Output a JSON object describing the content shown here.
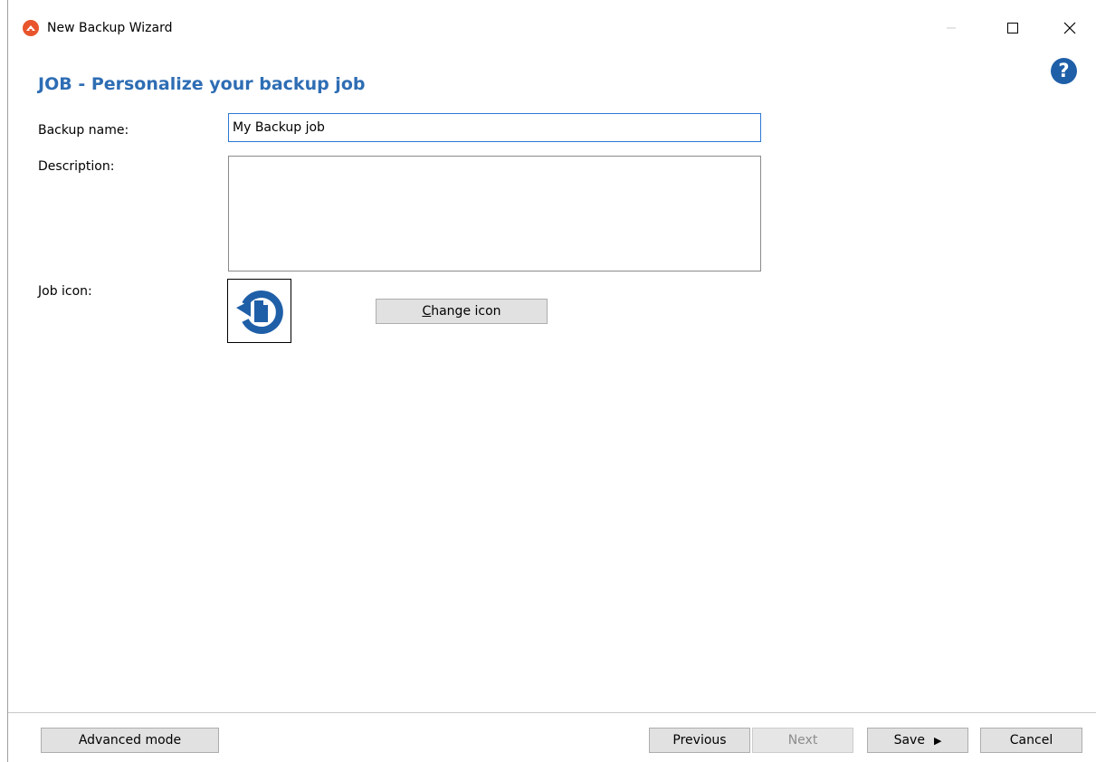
{
  "window": {
    "title": "New Backup Wizard",
    "minimize_icon": "minimize-icon",
    "maximize_icon": "maximize-icon",
    "close_icon": "close-icon"
  },
  "header": {
    "page_title": "JOB - Personalize your backup job",
    "help_icon": "help-icon"
  },
  "form": {
    "backup_name_label": "Backup name:",
    "backup_name_value": "My Backup job",
    "description_label": "Description:",
    "description_value": "",
    "job_icon_label": "Job icon:",
    "job_icon": "backup-restore-file-icon",
    "change_icon_prefix": "C",
    "change_icon_rest": "hange icon"
  },
  "footer": {
    "advanced_label": "Advanced mode",
    "previous_label": "Previous",
    "next_label": "Next",
    "save_label": "Save",
    "cancel_label": "Cancel"
  },
  "colors": {
    "accent": "#2e6db4",
    "app_icon": "#e8552d",
    "help_icon": "#1f5fa8"
  }
}
